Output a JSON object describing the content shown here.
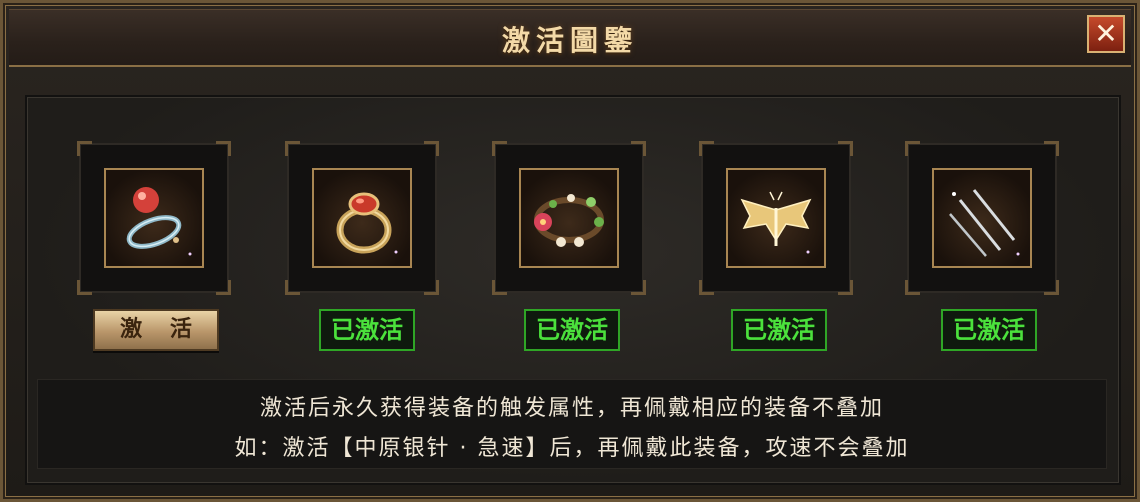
{
  "window": {
    "title": "激活圖鑒",
    "close_glyph": "✕"
  },
  "items": [
    {
      "icon": "gem-ring-icon",
      "status": "激 活"
    },
    {
      "icon": "ruby-ring-icon",
      "status": "已激活"
    },
    {
      "icon": "flower-wreath-icon",
      "status": "已激活"
    },
    {
      "icon": "golden-wings-icon",
      "status": "已激活"
    },
    {
      "icon": "silver-needles-icon",
      "status": "已激活"
    }
  ],
  "description": {
    "line1": "激活后永久获得装备的触发属性，再佩戴相应的装备不叠加",
    "line2": "如：激活【中原银针 · 急速】后，再佩戴此装备，攻速不会叠加"
  },
  "colors": {
    "activated_green": "#4be13c",
    "title_gold": "#f3d9a7",
    "frame_gold": "#a88652"
  }
}
